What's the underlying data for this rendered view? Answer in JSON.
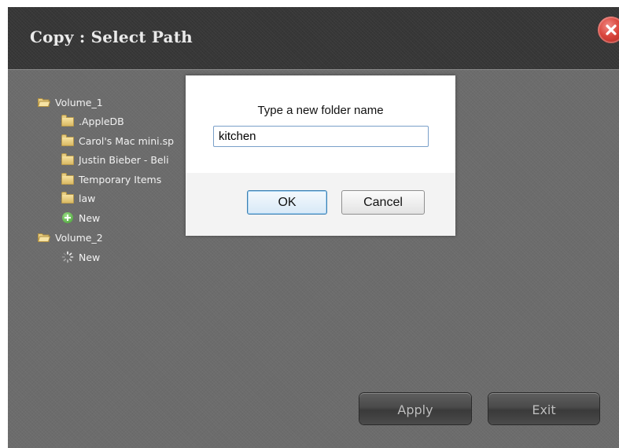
{
  "window": {
    "title": "Copy : Select Path"
  },
  "tree": {
    "items": [
      {
        "label": "Volume_1",
        "icon": "folder-open-icon",
        "level": 0
      },
      {
        "label": ".AppleDB",
        "icon": "folder-icon",
        "level": 1
      },
      {
        "label": "Carol's Mac mini.sp",
        "icon": "folder-icon",
        "level": 1
      },
      {
        "label": "Justin Bieber - Beli",
        "icon": "folder-icon",
        "level": 1
      },
      {
        "label": "Temporary Items",
        "icon": "folder-icon",
        "level": 1
      },
      {
        "label": "law",
        "icon": "folder-icon",
        "level": 1
      },
      {
        "label": "New",
        "icon": "add-icon",
        "level": 1
      },
      {
        "label": "Volume_2",
        "icon": "folder-open-icon",
        "level": 0
      },
      {
        "label": "New",
        "icon": "loading-spinner-icon",
        "level": 1
      }
    ]
  },
  "footer": {
    "apply_label": "Apply",
    "exit_label": "Exit"
  },
  "dialog": {
    "prompt": "Type a new folder name",
    "input_value": "kitchen",
    "ok_label": "OK",
    "cancel_label": "Cancel"
  },
  "colors": {
    "close_button": "#d9453c",
    "input_border": "#7aa0c9",
    "ok_border": "#3c7fb1"
  }
}
